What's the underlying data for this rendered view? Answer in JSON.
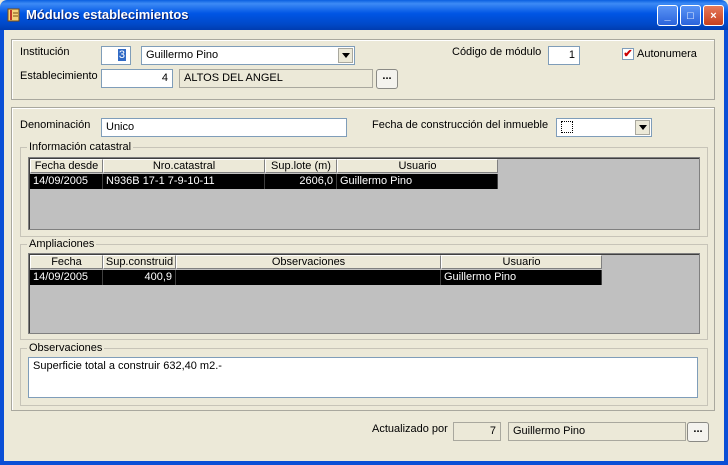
{
  "window": {
    "title": "Módulos establecimientos",
    "minimize": "_",
    "maximize": "□",
    "close": "×"
  },
  "header": {
    "institucion_label": "Institución",
    "institucion_code": "3",
    "institucion_name": "Guillermo Pino",
    "codigo_modulo_label": "Código de módulo",
    "codigo_modulo_value": "1",
    "autonumera_label": "Autonumera",
    "autonumera_checked": true,
    "establecimiento_label": "Establecimiento",
    "establecimiento_code": "4",
    "establecimiento_name": "ALTOS DEL ANGEL",
    "lookup_button": "..."
  },
  "details": {
    "denominacion_label": "Denominación",
    "denominacion_value": "Unico",
    "fecha_construccion_label": "Fecha de construcción del inmueble",
    "fecha_construccion_value": ""
  },
  "catastral": {
    "title": "Información catastral",
    "columns": [
      "Fecha desde",
      "Nro.catastral",
      "Sup.lote (m)",
      "Usuario"
    ],
    "rows": [
      [
        "14/09/2005",
        "N936B 17-1 7-9-10-11",
        "2606,0",
        "Guillermo Pino"
      ]
    ]
  },
  "ampliaciones": {
    "title": "Ampliaciones",
    "columns": [
      "Fecha",
      "Sup.construid",
      "Observaciones",
      "Usuario"
    ],
    "rows": [
      [
        "14/09/2005",
        "400,9",
        "",
        "Guillermo Pino"
      ]
    ]
  },
  "observaciones": {
    "title": "Observaciones",
    "text": "Superficie total a construir 632,40 m2.-"
  },
  "footer": {
    "actualizado_label": "Actualizado por",
    "actualizado_code": "7",
    "actualizado_name": "Guillermo Pino",
    "lookup_button": "..."
  }
}
